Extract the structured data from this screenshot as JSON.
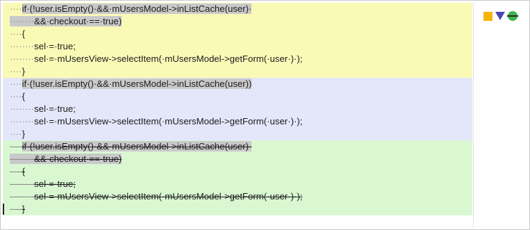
{
  "blocks": [
    {
      "name": "conflict-block-yours",
      "color": "#fafab7",
      "lines": [
        {
          "indent": "····",
          "code": "if·(!user.isEmpty()·&&·mUsersModel->inListCache(user)·",
          "highlight": "partial"
        },
        {
          "indent": "········",
          "code": "&&·checkout·==·true)",
          "highlight": "full"
        },
        {
          "indent": "····",
          "code": "{",
          "highlight": "none"
        },
        {
          "indent": "········",
          "code": "sel·=·true;",
          "highlight": "none"
        },
        {
          "indent": "········",
          "code": "sel·=·mUsersView->selectItem(·mUsersModel->getForm(·user·)·);",
          "highlight": "none"
        },
        {
          "indent": "····",
          "code": "}",
          "highlight": "none"
        }
      ]
    },
    {
      "name": "conflict-block-theirs",
      "color": "#e4e6fa",
      "lines": [
        {
          "indent": "····",
          "code": "if·(!user.isEmpty()·&&·mUsersModel->inListCache(user))",
          "highlight": "partial"
        },
        {
          "indent": "····",
          "code": "{",
          "highlight": "none"
        },
        {
          "indent": "········",
          "code": "sel·=·true;",
          "highlight": "none"
        },
        {
          "indent": "········",
          "code": "sel·=·mUsersView->selectItem(·mUsersModel->getForm(·user·)·);",
          "highlight": "none"
        },
        {
          "indent": "····",
          "code": "}",
          "highlight": "none"
        }
      ]
    },
    {
      "name": "conflict-block-base",
      "color": "#d9f8d2",
      "lines": [
        {
          "indent": "····",
          "code": "if·(!user.isEmpty()·&&·mUsersModel->inListCache(user)·",
          "highlight": "partial",
          "struck": true
        },
        {
          "indent": "········",
          "code": "&&·checkout·==·true)",
          "highlight": "full",
          "struck": true
        },
        {
          "indent": "····",
          "code": "{",
          "highlight": "none",
          "struck": true
        },
        {
          "indent": "········",
          "code": "sel·=·true;",
          "highlight": "none",
          "struck": true
        },
        {
          "indent": "········",
          "code": "sel·=·mUsersView->selectItem(·mUsersModel->getForm(·user·)·);",
          "highlight": "none",
          "struck": true
        },
        {
          "indent": "····",
          "code": "}",
          "highlight": "none",
          "struck": true
        }
      ]
    }
  ],
  "markers": [
    {
      "icon": "orange-square-marker-icon",
      "color": "#f4b400"
    },
    {
      "icon": "blue-triangle-marker-icon",
      "color": "#4a46b8"
    },
    {
      "icon": "green-circle-marker-icon",
      "color": "#3ab54a"
    }
  ]
}
